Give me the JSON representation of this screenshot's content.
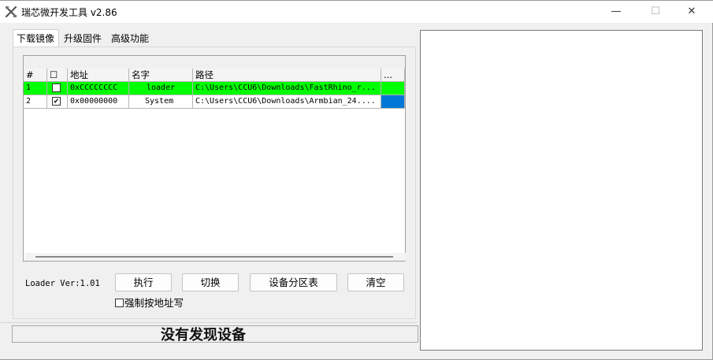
{
  "window": {
    "title": "瑞芯微开发工具 v2.86",
    "minimize": "—",
    "maximize": "☐",
    "close": "✕"
  },
  "tabs": [
    {
      "label": "下载镜像",
      "active": true
    },
    {
      "label": "升级固件",
      "active": false
    },
    {
      "label": "高级功能",
      "active": false
    }
  ],
  "grid": {
    "columns": [
      "#",
      "☐",
      "地址",
      "名字",
      "路径",
      "..."
    ],
    "rows": [
      {
        "index": "1",
        "checked": false,
        "address": "0xCCCCCCCC",
        "name": "loader",
        "path": "C:\\Users\\CCU6\\Downloads\\FastRhino_r...",
        "highlight": "#00ff00"
      },
      {
        "index": "2",
        "checked": true,
        "address": "0x00000000",
        "name": "System",
        "path": "C:\\Users\\CCU6\\Downloads\\Armbian_24....",
        "highlight": null
      }
    ],
    "selected_cell_color": "#0078d7"
  },
  "loader_version": "Loader Ver:1.01",
  "buttons": {
    "run": "执行",
    "switch": "切换",
    "partition_table": "设备分区表",
    "clear": "清空"
  },
  "force_write": {
    "label": "强制按地址写",
    "checked": false
  },
  "status": "没有发现设备"
}
